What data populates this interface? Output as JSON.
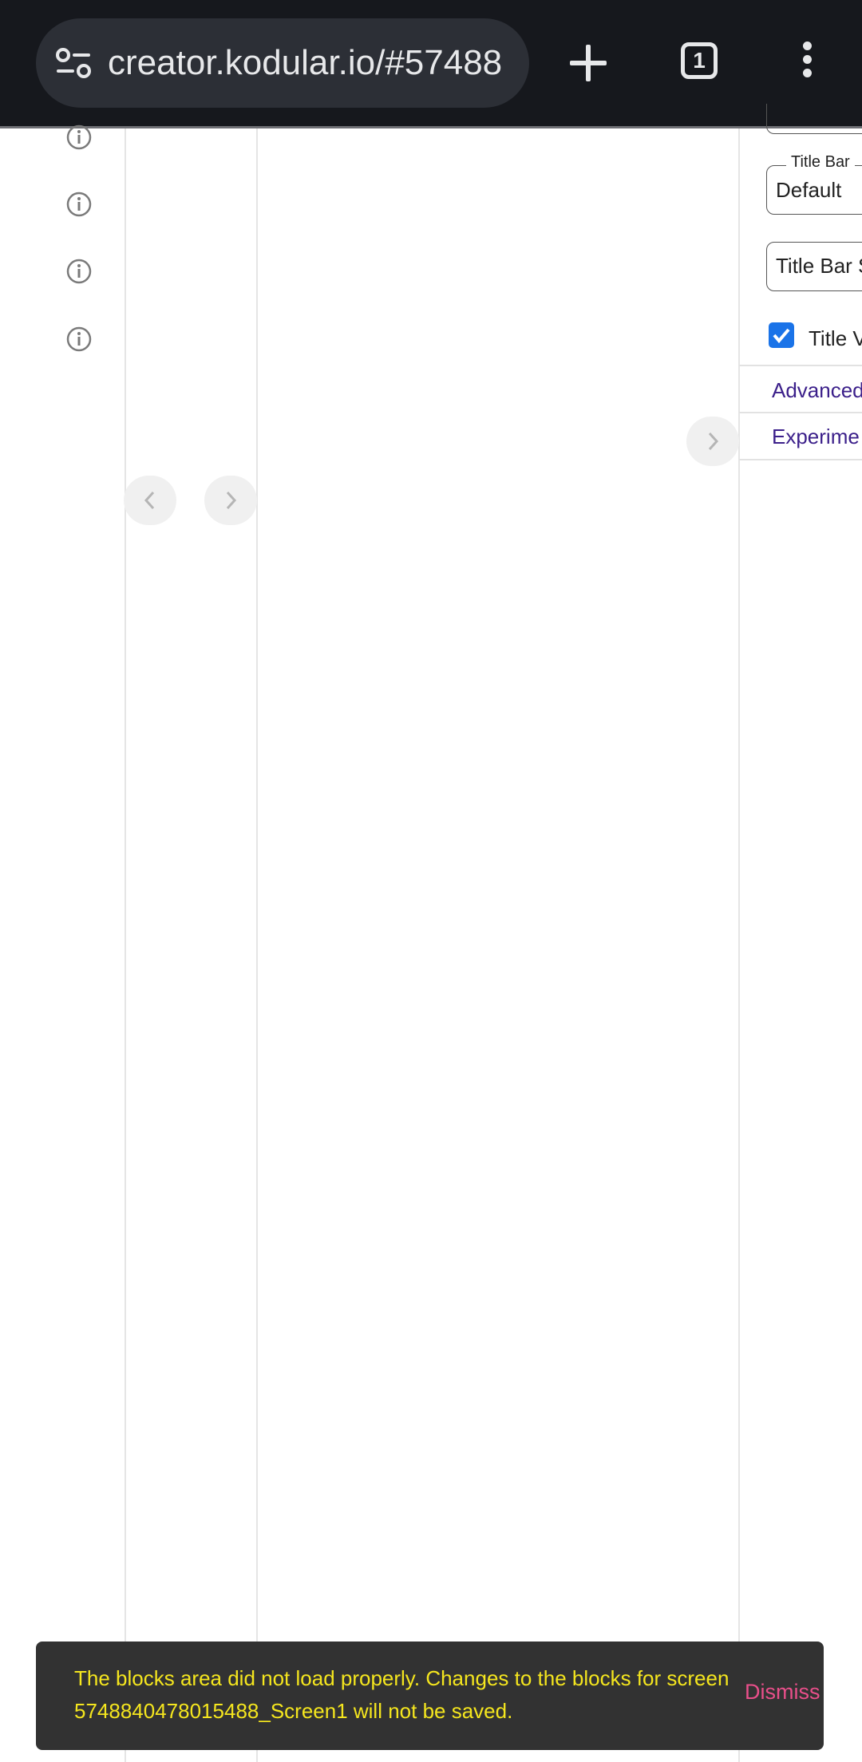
{
  "browser": {
    "url": "creator.kodular.io/#57488",
    "tab_count": "1"
  },
  "properties": {
    "title_bar_legend": "Title Bar",
    "title_bar_value": "Default",
    "title_bar_second_field": "Title Bar S",
    "title_visible_label": "Title V",
    "title_visible_checked": true,
    "sections": [
      "Advanced",
      "Experime"
    ]
  },
  "snackbar": {
    "message": "The blocks area did not load properly. Changes to the blocks for screen 5748840478015488_Screen1 will not be saved.",
    "action": "Dismiss"
  },
  "colors": {
    "topbar": "#16181d",
    "accent_link": "#3b1f8a",
    "snackbar_text": "#f5e61e",
    "snackbar_action": "#e94f8a",
    "checkbox": "#1a73e8"
  }
}
